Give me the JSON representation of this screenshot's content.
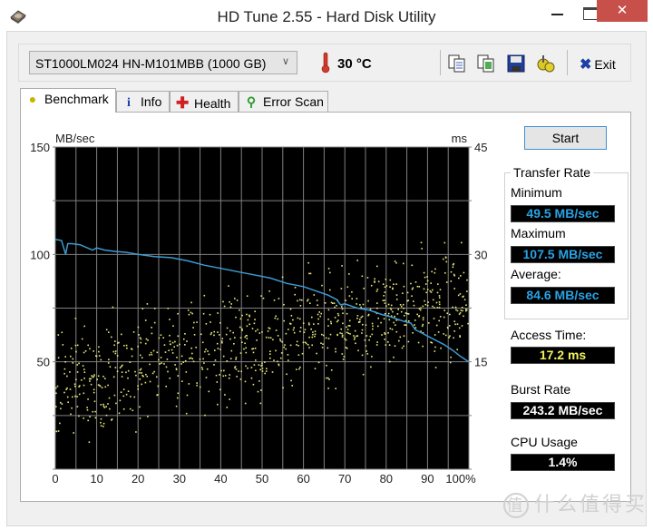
{
  "window": {
    "title": "HD Tune 2.55 - Hard Disk Utility",
    "minimize_label": "",
    "maximize_label": "",
    "close_label": "✕"
  },
  "toolbar": {
    "drive": "ST1000LM024 HN-M101MBB (1000 GB)",
    "temperature": "30 °C",
    "icons": [
      "copy-text-icon",
      "copy-screenshot-icon",
      "save-icon",
      "options-icon"
    ],
    "exit_label": "Exit"
  },
  "tabs": [
    {
      "label": "Benchmark",
      "icon": "lightbulb-icon",
      "active": true
    },
    {
      "label": "Info",
      "icon": "info-icon",
      "active": false
    },
    {
      "label": "Health",
      "icon": "health-cross-icon",
      "active": false
    },
    {
      "label": "Error Scan",
      "icon": "magnifier-icon",
      "active": false
    }
  ],
  "benchmark": {
    "start_label": "Start",
    "transfer_rate_title": "Transfer Rate",
    "minimum_label": "Minimum",
    "minimum_value": "49.5 MB/sec",
    "maximum_label": "Maximum",
    "maximum_value": "107.5 MB/sec",
    "average_label": "Average:",
    "average_value": "84.6 MB/sec",
    "access_time_label": "Access Time:",
    "access_time_value": "17.2 ms",
    "burst_rate_label": "Burst Rate",
    "burst_rate_value": "243.2 MB/sec",
    "cpu_usage_label": "CPU Usage",
    "cpu_usage_value": "1.4%"
  },
  "colors": {
    "plot_bg": "#000000",
    "grid": "#808080",
    "transfer_line": "#3c9bd1",
    "access_dots": "#e8e87a",
    "close_button": "#c7504a"
  },
  "chart_data": {
    "type": "line",
    "title": "",
    "xlabel": "%",
    "ylabel": "MB/sec",
    "y2label": "ms",
    "xlim": [
      0,
      100
    ],
    "ylim": [
      0,
      150
    ],
    "y2lim": [
      0,
      45
    ],
    "x_ticks": [
      "0",
      "10",
      "20",
      "30",
      "40",
      "50",
      "60",
      "70",
      "80",
      "90",
      "100%"
    ],
    "y_ticks": [
      "150",
      "100",
      "50"
    ],
    "y2_ticks": [
      "45",
      "30",
      "15"
    ],
    "grid": true,
    "series": [
      {
        "name": "Transfer Rate (MB/sec)",
        "axis": "left",
        "x": [
          0,
          1.5,
          2.5,
          3,
          4,
          6,
          9,
          10,
          12,
          14,
          17,
          20,
          24,
          28,
          32,
          36,
          40,
          44,
          48,
          52,
          56,
          60,
          63,
          66,
          68,
          69,
          70,
          73,
          76,
          79,
          81,
          84,
          86,
          87,
          88,
          90,
          92,
          94,
          96,
          98,
          100
        ],
        "values": [
          107,
          106.5,
          100,
          105,
          105,
          104.5,
          102,
          103,
          102,
          101.5,
          101,
          100,
          99,
          98.5,
          97,
          95,
          93.5,
          92,
          90.5,
          89,
          86.5,
          85,
          83,
          81,
          79,
          76.5,
          77,
          75,
          74,
          72,
          71,
          69,
          68,
          65,
          64,
          62,
          60,
          58,
          55.5,
          52.5,
          50
        ]
      },
      {
        "name": "Access Time (ms)",
        "axis": "right",
        "style": "scatter",
        "description": "random scatter rising from ~8-18 ms at 0% to ~18-30 ms at 100%; mean 17.2 ms"
      }
    ]
  }
}
